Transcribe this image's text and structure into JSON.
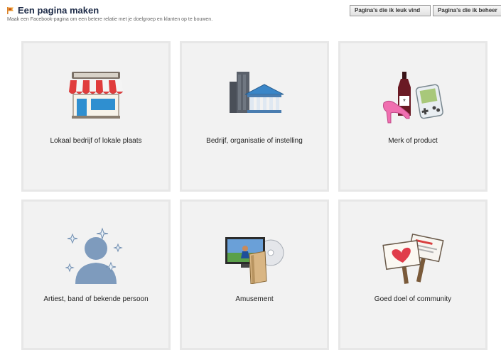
{
  "header": {
    "title": "Een pagina maken",
    "subtitle": "Maak een Facebook-pagina om een betere relatie met je doelgroep en klanten op te bouwen."
  },
  "buttons": {
    "liked_pages": "Pagina's die ik leuk vind",
    "managed_pages": "Pagina's die ik beheer"
  },
  "categories": [
    {
      "label": "Lokaal bedrijf of lokale plaats",
      "icon": "storefront-icon"
    },
    {
      "label": "Bedrijf, organisatie of instelling",
      "icon": "office-building-icon"
    },
    {
      "label": "Merk of product",
      "icon": "product-icon"
    },
    {
      "label": "Artiest, band of bekende persoon",
      "icon": "celebrity-icon"
    },
    {
      "label": "Amusement",
      "icon": "entertainment-icon"
    },
    {
      "label": "Goed doel of community",
      "icon": "community-signs-icon"
    }
  ],
  "colors": {
    "title": "#1c2a47",
    "tile_bg": "#f2f2f2",
    "tile_border": "#e7e7e7"
  }
}
